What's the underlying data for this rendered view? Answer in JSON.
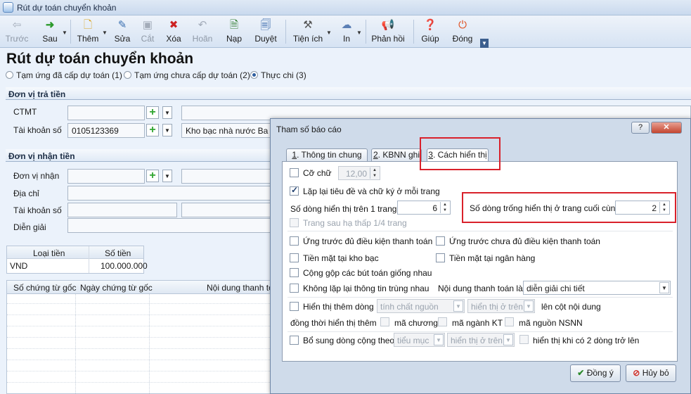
{
  "window": {
    "title": "Rút dự toán chuyển khoản"
  },
  "toolbar": {
    "back": "Trước",
    "next": "Sau",
    "add": "Thêm",
    "edit": "Sửa",
    "cut": "Cắt",
    "delete": "Xóa",
    "undo": "Hoãn",
    "load": "Nạp",
    "approve": "Duyệt",
    "utilities": "Tiện ích",
    "print": "In",
    "feedback": "Phản hồi",
    "help": "Giúp",
    "close": "Đóng"
  },
  "page": {
    "title": "Rút dự toán chuyển khoản",
    "options": [
      "Tạm ứng đã cấp dự toán (1)",
      "Tạm ứng chưa cấp dự toán (2)",
      "Thực chi (3)"
    ],
    "selected_option": "Thực chi (3)"
  },
  "payer": {
    "header": "Đơn vị trả tiền",
    "ctmt_label": "CTMT",
    "ctmt_value": "",
    "ctmt_desc": "",
    "account_label": "Tài khoản số",
    "account_value": "0105123369",
    "bank_value": "Kho bạc nhà nước Ba Đình"
  },
  "payee": {
    "header": "Đơn vị nhận tiền",
    "unit_label": "Đơn vị nhận",
    "unit_value": "",
    "address_label": "Địa chỉ",
    "address_value": "",
    "account_label": "Tài khoản số",
    "account_value": "",
    "description_label": "Diễn giải",
    "description_value": ""
  },
  "money": {
    "col_currency": "Loại tiền",
    "col_amount": "Số tiền",
    "currency": "VND",
    "amount": "100.000.000"
  },
  "grid": {
    "columns": [
      "Số chứng từ gốc",
      "Ngày chứng từ gốc",
      "Nội dung thanh toán"
    ]
  },
  "dialog": {
    "title": "Tham số báo cáo",
    "help_btn": "?",
    "close_btn": "✕",
    "tabs": [
      {
        "num": "1",
        "label": ". Thông tin chung"
      },
      {
        "num": "2",
        "label": ". KBNN ghi"
      },
      {
        "num": "3",
        "label": ". Cách hiển thị"
      }
    ],
    "font_size_label": "Cỡ chữ",
    "font_size_value": "12,00",
    "repeat_header_label": "Lặp lại tiêu đề và chữ ký ở mỗi trang",
    "rows_per_page_label": "Số dòng hiển thị trên 1 trang",
    "rows_per_page_value": "6",
    "blank_rows_label": "Số dòng trống hiển thị ở trang cuối cùng",
    "blank_rows_value": "2",
    "next_page_label": "Trang sau hạ thấp 1/4 trang",
    "adv_enough_label": "Ứng trước đủ điều kiện thanh toán",
    "adv_not_enough_label": "Ứng trước chưa đủ điều kiện thanh toán",
    "cash_treasury_label": "Tiền mặt tại kho bạc",
    "cash_bank_label": "Tiền mặt tại ngân hàng",
    "merge_label": "Cộng gộp các bút toán giống nhau",
    "no_repeat_label": "Không lặp lại thông tin trùng nhau",
    "payment_content_label": "Nội dung thanh toán là",
    "payment_content_value": "diễn giải chi tiết",
    "show_more_label": "Hiển thị thêm dòng",
    "show_more_combo1": "tính chất nguồn",
    "show_more_combo2": "hiển thị ở trên",
    "show_more_suffix": "lên cột nội dung",
    "also_show_label": "đồng thời hiển thị thêm",
    "chapter_label": "mã chương",
    "industry_label": "mã ngành KT",
    "source_label": "mã nguồn NSNN",
    "add_total_label": "Bổ sung dòng cộng theo",
    "add_total_combo1": "tiểu mục",
    "add_total_combo2": "hiển thị ở trên",
    "show_when_label": "hiển thị khi có 2 dòng trở lên",
    "ok_btn": "Đồng ý",
    "cancel_btn": "Hủy bỏ"
  }
}
